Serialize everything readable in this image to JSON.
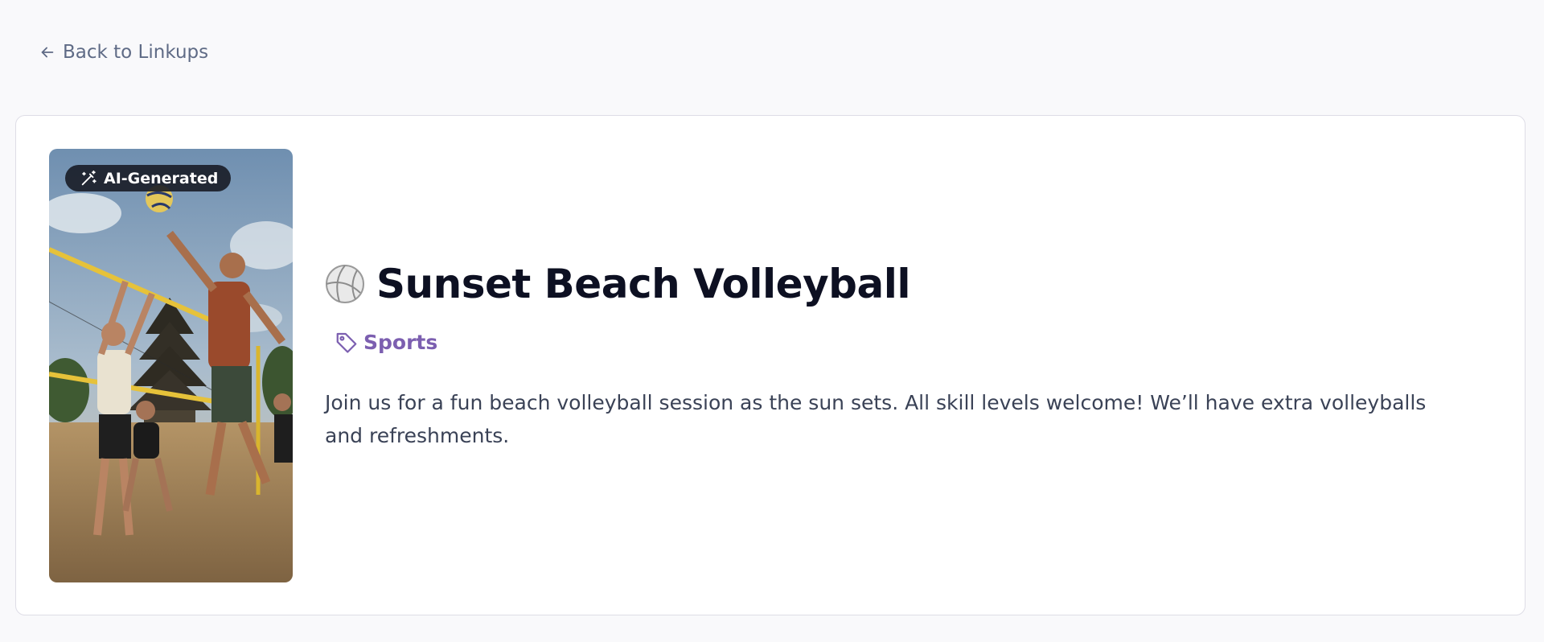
{
  "nav": {
    "back_label": "Back to Linkups"
  },
  "linkup": {
    "image_badge": "AI-Generated",
    "title": "Sunset Beach Volleyball",
    "emoji_icon": "volleyball-icon",
    "category": "Sports",
    "description": "Join us for a fun beach volleyball session as the sun sets. All skill levels welcome! We’ll have extra volleyballs and refreshments."
  },
  "colors": {
    "background": "#f9f9fb",
    "card": "#ffffff",
    "title": "#0d1022",
    "category": "#7c5fb0",
    "muted": "#5f6b86"
  }
}
